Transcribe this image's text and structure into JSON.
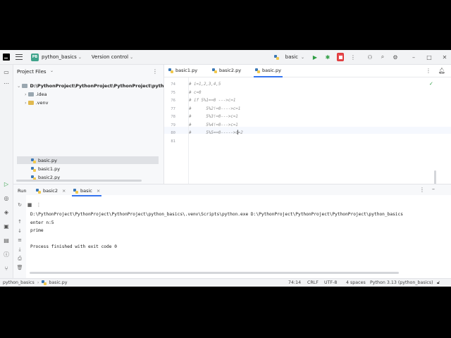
{
  "titlebar": {
    "project_badge": "PB",
    "project_name": "python_basics",
    "vcs": "Version control",
    "run_config": "basic"
  },
  "project_panel": {
    "header": "Project Files",
    "root": "D:\\PythonProject\\PythonProject\\PythonProject\\python",
    "items": [
      ".idea",
      ".venv",
      "basic.py",
      "basic1.py",
      "basic2.py"
    ]
  },
  "editor": {
    "tabs": [
      "basic1.py",
      "basic2.py",
      "basic.py"
    ],
    "active_tab": "basic.py",
    "lines": [
      {
        "n": "74",
        "text": "# i=1,2,3,4,5"
      },
      {
        "n": "75",
        "text": "# c=0"
      },
      {
        "n": "76",
        "text": "# if 5%1==0 --->c=1"
      },
      {
        "n": "77",
        "text": "#      5%2!=0---->c=1"
      },
      {
        "n": "78",
        "text": "#      5%3!=0--->c=1"
      },
      {
        "n": "79",
        "text": "#      5%4!=0--->c=1"
      },
      {
        "n": "80",
        "text": "#      5%5==0----->c=2"
      },
      {
        "n": "81",
        "text": ""
      }
    ]
  },
  "run_panel": {
    "title": "Run",
    "tabs": [
      "basic2",
      "basic"
    ],
    "console": [
      "D:\\PythonProject\\PythonProject\\PythonProject\\python_basics\\.venv\\Scripts\\python.exe D:\\PythonProject\\PythonProject\\PythonProject\\python_basics",
      "enter n:5",
      "prime",
      "",
      "Process finished with exit code 0"
    ]
  },
  "statusbar": {
    "breadcrumb_project": "python_basics",
    "breadcrumb_file": "basic.py",
    "position": "74:14",
    "line_ending": "CRLF",
    "encoding": "UTF-8",
    "indent": "4 spaces",
    "interpreter": "Python 3.13 (python_basics)"
  }
}
